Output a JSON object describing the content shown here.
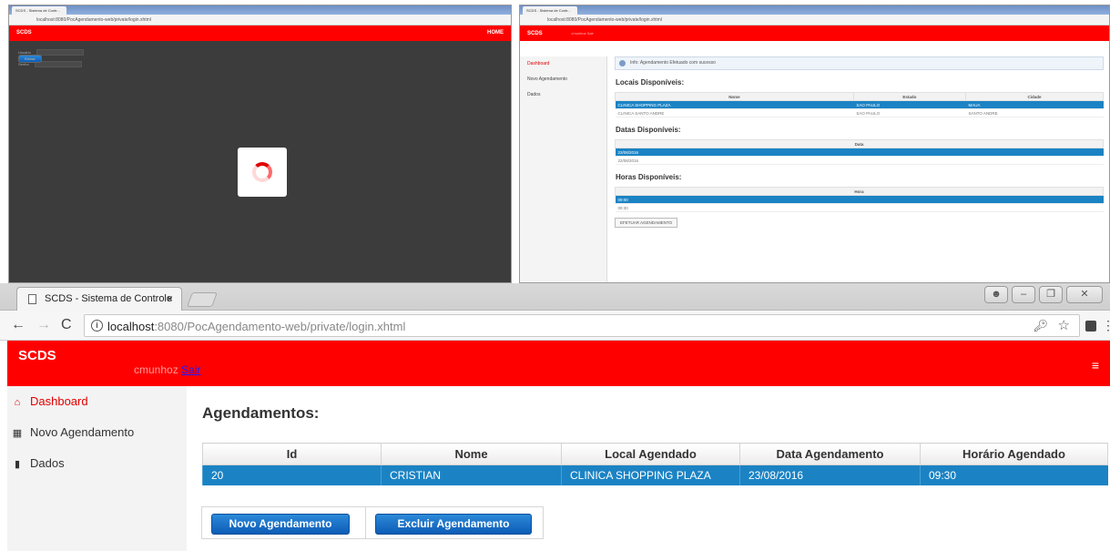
{
  "thumb_left": {
    "tab_title": "SCDS - Sistema de Contr...",
    "url": "localhost:8080/PocAgendamento-web/private/login.xhtml",
    "brand": "SCDS",
    "header_right": "HOME",
    "login_user_label": "Usuário",
    "login_pass_label": "Senha",
    "login_button": "Entrar"
  },
  "thumb_right": {
    "tab_title": "SCDS - Sistema de Contr...",
    "url": "localhost:8080/PocAgendamento-web/private/login.xhtml",
    "brand": "SCDS",
    "user": "cmunhoz Sair",
    "nav": [
      "Dashboard",
      "Novo Agendamento",
      "Dados"
    ],
    "message": "Info: Agendamento Efetuado com sucesso",
    "locais_title": "Locais Disponíveis:",
    "locais_headers": [
      "Nome",
      "Estado",
      "Cidade"
    ],
    "locais_rows": [
      [
        "CLINICA SHOPPING PLAZA",
        "SAO PAULO",
        "MAUA"
      ],
      [
        "CLINICA SANTO ANDRE",
        "SAO PAULO",
        "SANTO ANDRE"
      ]
    ],
    "datas_title": "Datas Disponíveis:",
    "datas_header": "Data",
    "datas_rows": [
      "23/08/2016",
      "22/08/2016"
    ],
    "horas_title": "Horas Disponíveis:",
    "horas_header": "Hora",
    "horas_rows": [
      "09:00",
      "09:30"
    ],
    "submit": "EFETUAR AGENDAMENTO"
  },
  "browser": {
    "tab_title": "SCDS - Sistema de Controle",
    "tab_close": "×",
    "url_host": "localhost",
    "url_rest": ":8080/PocAgendamento-web/private/login.xhtml",
    "back": "←",
    "forward": "→",
    "reload": "C"
  },
  "header": {
    "brand": "SCDS",
    "user_name": "cmunhoz",
    "logout_link": "Sair",
    "menu_icon": "≡"
  },
  "sidebar": {
    "items": [
      {
        "label": "Dashboard",
        "icon": "home-icon",
        "active": true
      },
      {
        "label": "Novo Agendamento",
        "icon": "calendar-icon",
        "active": false
      },
      {
        "label": "Dados",
        "icon": "book-icon",
        "active": false
      }
    ]
  },
  "main": {
    "title": "Agendamentos:",
    "table": {
      "headers": [
        "Id",
        "Nome",
        "Local Agendado",
        "Data Agendamento",
        "Horário Agendado"
      ],
      "rows": [
        [
          "20",
          "CRISTIAN",
          "CLINICA SHOPPING PLAZA",
          "23/08/2016",
          "09:30"
        ]
      ]
    },
    "buttons": {
      "novo": "Novo Agendamento",
      "excluir": "Excluir Agendamento"
    }
  },
  "colors": {
    "brand_red": "#ff0000",
    "selection_blue": "#1b83c4",
    "button_blue": "#0d5cb6"
  }
}
